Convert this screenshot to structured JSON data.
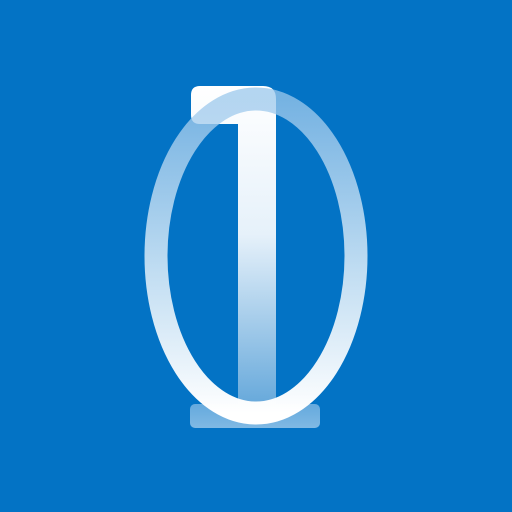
{
  "app_icon": {
    "glyph_one": "1",
    "glyph_zero": "0"
  },
  "colors": {
    "background": "#0373c5",
    "glyph_light": "#ffffff",
    "glyph_mid": "#bcd9f0",
    "glyph_deep": "#5aa0d6"
  },
  "icons": {
    "logo": "one-zero-logo-icon"
  }
}
